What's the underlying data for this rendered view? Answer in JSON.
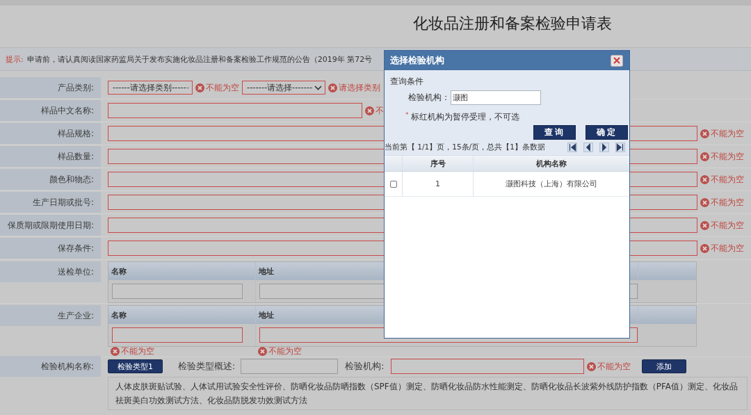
{
  "page_title": "化妆品注册和备案检验申请表",
  "notice": {
    "label": "提示:",
    "text": "申请前，请认真阅读国家药监局关于发布实施化妆品注册和备案检验工作规范的公告（2019年 第72号"
  },
  "category": {
    "label": "产品类别:",
    "selects": [
      {
        "value": "------请选择类别-----",
        "error": "不能为空"
      },
      {
        "value": "-------请选择-------",
        "error": "请选择类别"
      }
    ]
  },
  "fields": [
    {
      "label": "样品中文名称:",
      "kind": "short",
      "error": "不"
    },
    {
      "label": "样品规格:",
      "kind": "long",
      "error": "不能为空"
    },
    {
      "label": "样品数量:",
      "kind": "long",
      "error": "不能为空"
    },
    {
      "label": "颜色和物态:",
      "kind": "long",
      "error": "不能为空"
    },
    {
      "label": "生产日期或批号:",
      "kind": "long",
      "error": "不能为空"
    },
    {
      "label": "保质期或限期使用日期:",
      "kind": "long",
      "error": "不能为空"
    },
    {
      "label": "保存条件:",
      "kind": "long",
      "error": "不能为空"
    }
  ],
  "sender": {
    "label": "送检单位:",
    "columns": [
      "名称",
      "地址"
    ]
  },
  "manufacturer": {
    "label": "生产企业:",
    "columns": [
      "名称",
      "地址"
    ],
    "errors": [
      "不能为空",
      "不能为空"
    ]
  },
  "institution": {
    "label": "检验机构名称:",
    "type_button": "检验类型1",
    "summary_label": "检验类型概述:",
    "institution_label": "检验机构:",
    "error": "不能为空",
    "add_button": "添加",
    "description": "人体皮肤斑贴试验、人体试用试验安全性评价、防晒化妆品防晒指数（SPF值）测定、防晒化妆品防水性能测定、防晒化妆品长波紫外线防护指数（PFA值）测定、化妆品祛斑美白功效测试方法、化妆品防脱发功效测试方法"
  },
  "dialog": {
    "title": "选择检验机构",
    "section": "查询条件",
    "search_label": "检验机构：",
    "search_value": "灏图",
    "note_mark": "*",
    "note": "标红机构为暂停受理，不可选",
    "buttons": [
      "查询",
      "确定"
    ],
    "pager": "当前第【 1/1】页，15条/页，总共【1】条数据",
    "columns": [
      "序号",
      "机构名称"
    ],
    "rows": [
      {
        "checked": false,
        "index": "1",
        "name": "灏图科技（上海）有限公司"
      }
    ]
  }
}
